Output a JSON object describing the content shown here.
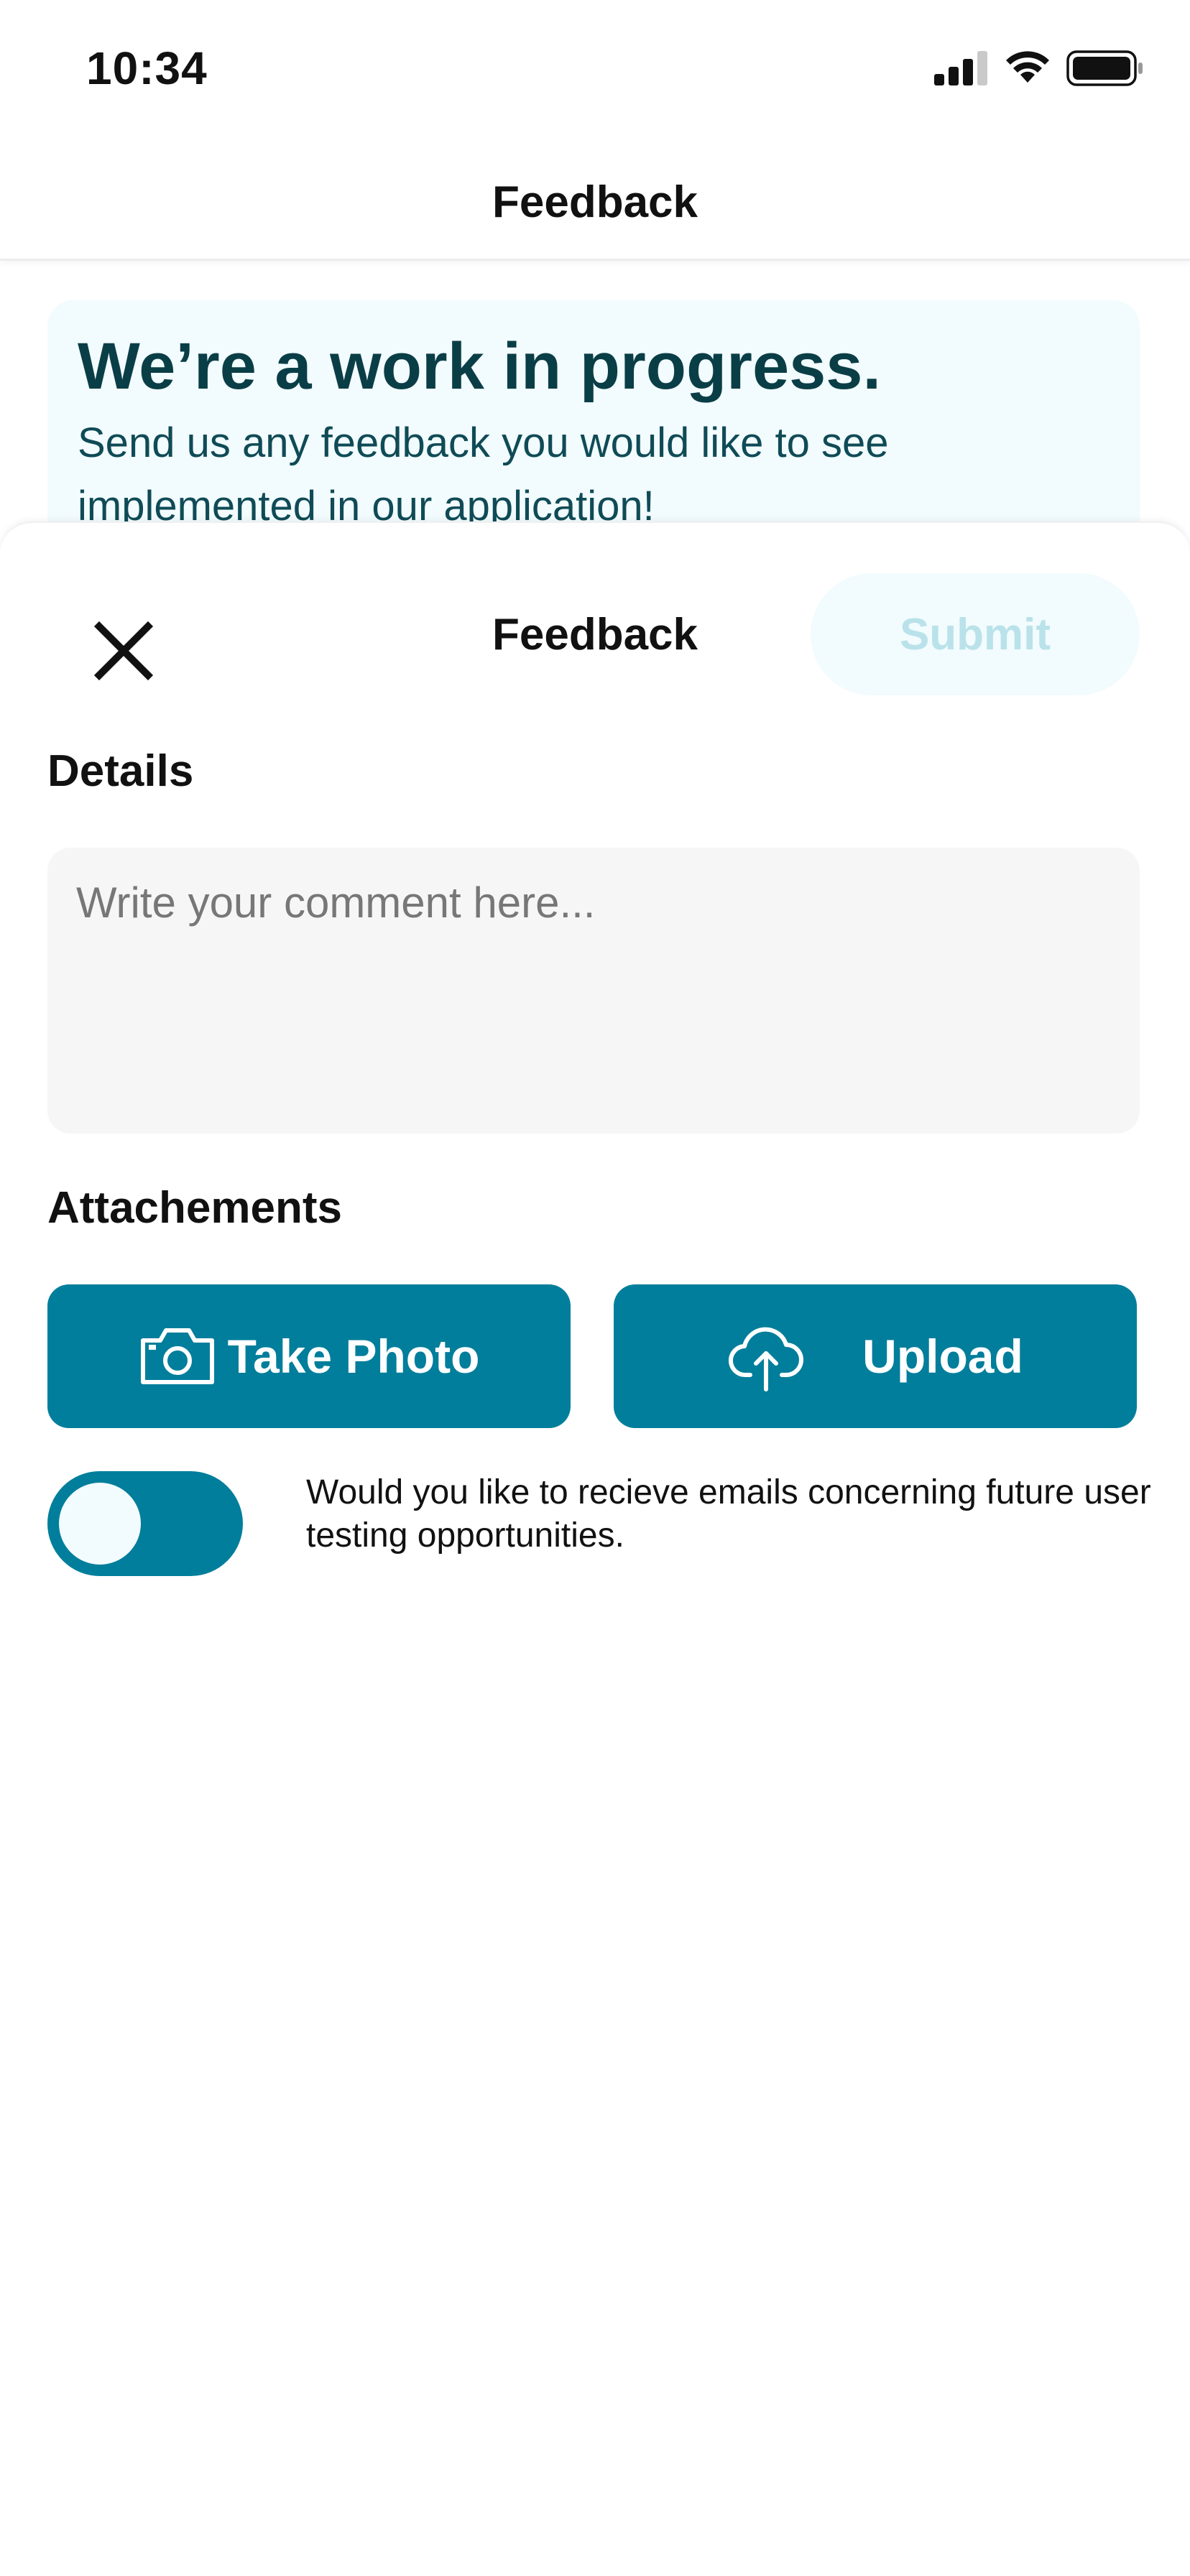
{
  "status_bar": {
    "time": "10:34",
    "icons": [
      "cellular-signal-icon",
      "wifi-icon",
      "battery-icon"
    ]
  },
  "top_nav": {
    "title": "Feedback"
  },
  "banner": {
    "title": "We’re a work in progress.",
    "body": "Send us any feedback you would like to see implemented in our application!"
  },
  "sheet": {
    "title": "Feedback",
    "close_icon": "close-icon",
    "submit_label": "Submit",
    "submit_enabled": false,
    "details_label": "Details",
    "comment_placeholder": "Write your comment here...",
    "comment_value": "",
    "attachments_label": "Attachements",
    "take_photo_label": "Take Photo",
    "take_photo_icon": "camera-icon",
    "upload_label": "Upload",
    "upload_icon": "cloud-upload-icon",
    "email_opt_in_text": "Would you like to recieve emails concerning future user testing opportunities.",
    "email_opt_in_on": false
  },
  "colors": {
    "primary": "#007e9b",
    "banner_bg": "#f2fbfd",
    "banner_title": "#0a3e47",
    "submit_disabled_text": "#b9e2ea",
    "input_bg": "#f6f6f6"
  }
}
